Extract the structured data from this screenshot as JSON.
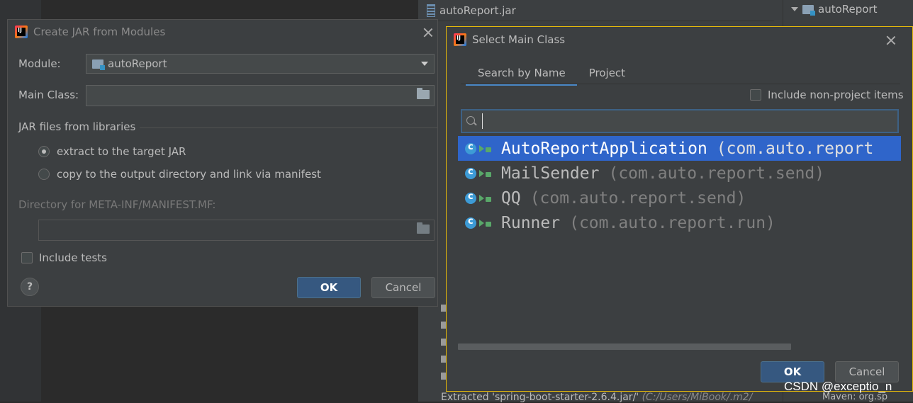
{
  "background": {
    "tab_label": "autoReport.jar",
    "tree_root": "autoReport",
    "status_text": "Extracted 'spring-boot-starter-2.6.4.jar/'",
    "status_path": "(C:/Users/MiBook/.m2/",
    "maven_text": "Maven: org.sp"
  },
  "create_jar": {
    "title": "Create JAR from Modules",
    "module_label": "Module:",
    "module_value": "autoReport",
    "main_class_label": "Main Class:",
    "main_class_value": "",
    "libraries_section": "JAR files from libraries",
    "radio_extract": "extract to the target JAR",
    "radio_copy": "copy to the output directory and link via manifest",
    "manifest_label": "Directory for META-INF/MANIFEST.MF:",
    "include_tests": "Include tests",
    "help_label": "?",
    "ok": "OK",
    "cancel": "Cancel"
  },
  "select_main": {
    "title": "Select Main Class",
    "tabs": [
      {
        "label": "Search by Name"
      },
      {
        "label": "Project"
      }
    ],
    "include_non_project": "Include non-project items",
    "search_value": "",
    "items": [
      {
        "name": "AutoReportApplication",
        "pkg": "(com.auto.report",
        "selected": true
      },
      {
        "name": "MailSender",
        "pkg": "(com.auto.report.send)",
        "selected": false
      },
      {
        "name": "QQ",
        "pkg": "(com.auto.report.send)",
        "selected": false
      },
      {
        "name": "Runner",
        "pkg": "(com.auto.report.run)",
        "selected": false
      }
    ],
    "ok": "OK",
    "cancel": "Cancel"
  },
  "watermark": "CSDN @exceptio_n",
  "colors": {
    "dialog_bg": "#3c3f41",
    "selection": "#2f65ca",
    "primary_button": "#365880",
    "focus_border": "#e5b90b"
  }
}
